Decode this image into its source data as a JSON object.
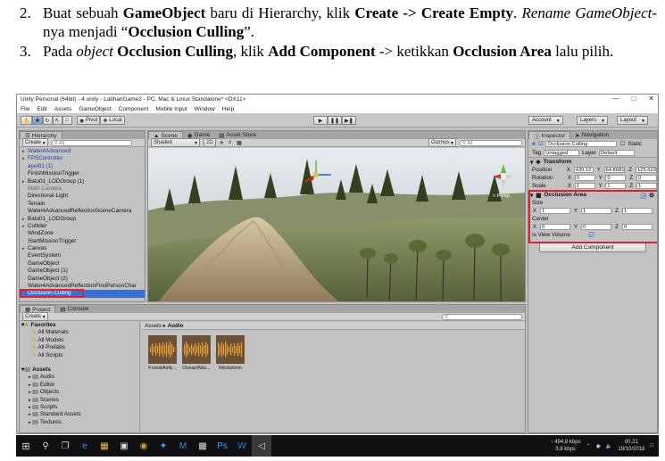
{
  "doc": {
    "step2": {
      "num": "2.",
      "t1": "Buat sebuah ",
      "b1": "GameObject",
      "t2": " baru di Hierarchy, klik ",
      "b2": "Create -> Create Empty",
      "t3": ". ",
      "i1": "Rename GameObject",
      "t4": "-nya menjadi “",
      "b3": "Occlusion Culling",
      "t5": "”."
    },
    "step3": {
      "num": "3.",
      "t1": "Pada ",
      "i1": "object",
      "t2": " ",
      "b1": "Occlusion Culling",
      "t3": ", klik ",
      "b2": "Add Component",
      "t4": " -> ketikkan ",
      "b3": "Occlusion Area",
      "t5": " lalu pilih."
    }
  },
  "window": {
    "title": "Unity Personal (64bit) - 4.unity - LatihanGame2 - PC, Mac & Linux Standalone* <DX11>",
    "menu": [
      "File",
      "Edit",
      "Assets",
      "GameObject",
      "Component",
      "Mobile Input",
      "Window",
      "Help"
    ],
    "toolbar": {
      "pivot": "Pivot",
      "local": "Local",
      "account": "Account",
      "layers": "Layers",
      "layout": "Layout"
    }
  },
  "hierarchy": {
    "tab": "Hierarchy",
    "create": "Create",
    "search_placeholder": "All",
    "items": [
      {
        "label": "Water4Advanced",
        "style": "blue",
        "arrow": "▸"
      },
      {
        "label": "FPSController",
        "style": "blue",
        "arrow": "▸"
      },
      {
        "label": "apel01 (1)",
        "style": "blue",
        "arrow": ""
      },
      {
        "label": "FinishMissionTrigger",
        "style": "",
        "arrow": ""
      },
      {
        "label": "Batu01_LODGroup (1)",
        "style": "",
        "arrow": "▸"
      },
      {
        "label": "Main Camera",
        "style": "gray",
        "arrow": ""
      },
      {
        "label": "Directional Light",
        "style": "",
        "arrow": ""
      },
      {
        "label": "Terrain",
        "style": "",
        "arrow": ""
      },
      {
        "label": "Water4AdvancedReflectionSceneCamera",
        "style": "",
        "arrow": ""
      },
      {
        "label": "Batu01_LODGroup",
        "style": "",
        "arrow": "▸"
      },
      {
        "label": "Collider",
        "style": "",
        "arrow": "▸"
      },
      {
        "label": "WindZone",
        "style": "",
        "arrow": ""
      },
      {
        "label": "StartMissionTrigger",
        "style": "",
        "arrow": ""
      },
      {
        "label": "Canvas",
        "style": "",
        "arrow": "▸"
      },
      {
        "label": "EventSystem",
        "style": "",
        "arrow": ""
      },
      {
        "label": "GameObject",
        "style": "",
        "arrow": ""
      },
      {
        "label": "GameObject (1)",
        "style": "",
        "arrow": ""
      },
      {
        "label": "GameObject (2)",
        "style": "",
        "arrow": ""
      },
      {
        "label": "Water4AdvancedReflectionFirstPersonChar",
        "style": "",
        "arrow": ""
      },
      {
        "label": "Occlusion Culling",
        "style": "sel",
        "arrow": ""
      }
    ]
  },
  "scene": {
    "tabs": [
      "Scene",
      "Game",
      "Asset Store"
    ],
    "shaded": "Shaded",
    "mode2d": "2D",
    "gizmos": "Gizmos",
    "search_placeholder": "All",
    "persp": "< Persp"
  },
  "inspector": {
    "tabs": [
      "Inspector",
      "Navigation"
    ],
    "object_name": "Occlusion Culling",
    "static_label": "Static",
    "tag_label": "Tag",
    "tag_value": "Untagged",
    "layer_label": "Layer",
    "layer_value": "Default",
    "transform": {
      "title": "Transform",
      "position_label": "Position",
      "position": {
        "x": "439.12",
        "y": "64.8681",
        "z": "125.623"
      },
      "rotation_label": "Rotation",
      "rotation": {
        "x": "0",
        "y": "0",
        "z": "0"
      },
      "scale_label": "Scale",
      "scale": {
        "x": "1",
        "y": "1",
        "z": "1"
      }
    },
    "occlusion_area": {
      "title": "Occlusion Area",
      "size_label": "Size",
      "size": {
        "x": "1",
        "y": "1",
        "z": "1"
      },
      "center_label": "Center",
      "center": {
        "x": "0",
        "y": "0",
        "z": "0"
      },
      "volume_label": "Is View Volume",
      "volume_checked": true
    },
    "add_component": "Add Component"
  },
  "project": {
    "tabs": [
      "Project",
      "Console"
    ],
    "create": "Create",
    "favorites_label": "Favorites",
    "favorites": [
      "All Materials",
      "All Models",
      "All Prefabs",
      "All Scripts"
    ],
    "assets_label": "Assets",
    "folders": [
      "Audio",
      "Editor",
      "Objects",
      "Scenes",
      "Scripts",
      "Standard Assets",
      "Textures"
    ],
    "breadcrumb_root": "Assets",
    "breadcrumb_sep": "▸",
    "breadcrumb_leaf": "Audio",
    "files": [
      "ForestAmb...",
      "OceanWav...",
      "Windstorm"
    ]
  },
  "taskbar": {
    "net_up": "494,8 kbps",
    "net_down": "3,8 kbps",
    "time": "00.21",
    "date": "19/10/2018"
  },
  "colors": {
    "highlight": "#e0202a",
    "selection": "#3d6fd1",
    "panel": "#c2c2c2"
  }
}
